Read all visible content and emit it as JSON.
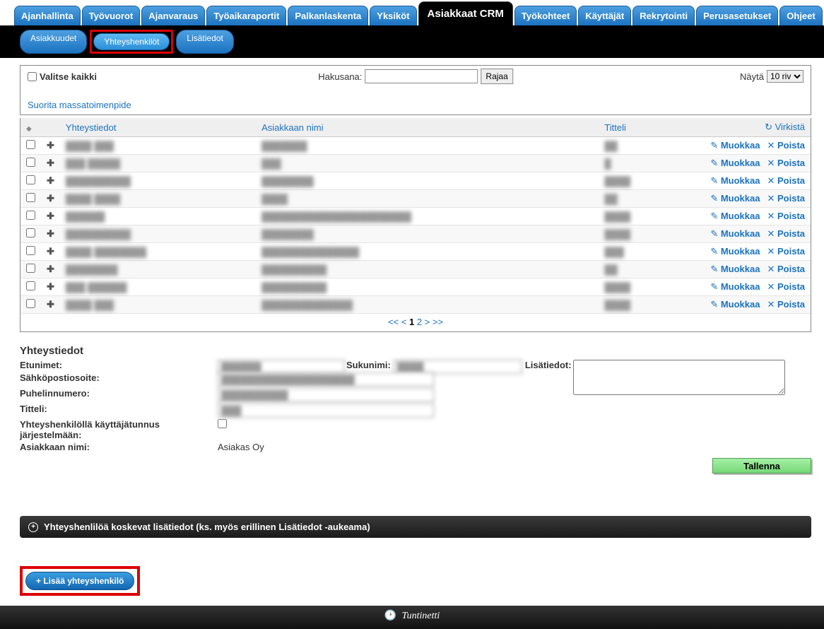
{
  "main_tabs": {
    "items": [
      "Ajanhallinta",
      "Työvuorot",
      "Ajanvaraus",
      "Työaikaraportit",
      "Palkanlaskenta",
      "Yksiköt",
      "Asiakkaat CRM",
      "Työkohteet",
      "Käyttäjät",
      "Rekrytointi",
      "Perusasetukset",
      "Ohjeet"
    ],
    "active_index": 6
  },
  "sub_tabs": {
    "items": [
      "Asiakkuudet",
      "Yhteyshenkilöt",
      "Lisätiedot"
    ],
    "active_index": 1
  },
  "controls": {
    "select_all": "Valitse kaikki",
    "search_label": "Hakusana:",
    "search_value": "",
    "search_button": "Rajaa",
    "rows_label": "Näytä",
    "rows_value": "10 riv",
    "mass_action": "Suorita massatoimenpide"
  },
  "table": {
    "columns": {
      "contact": "Yhteystiedot",
      "customer": "Asiakkaan nimi",
      "title": "Titteli",
      "refresh": "Virkistä"
    },
    "actions": {
      "edit": "Muokkaa",
      "delete": "Poista"
    },
    "rows": [
      {
        "contact": "████ ███",
        "customer": "███████",
        "title": "██"
      },
      {
        "contact": "███ █████",
        "customer": "███",
        "title": "█"
      },
      {
        "contact": "██████████",
        "customer": "████████",
        "title": "████"
      },
      {
        "contact": "████ ████",
        "customer": "████",
        "title": "██"
      },
      {
        "contact": "██████",
        "customer": "███████████████████████",
        "title": "████"
      },
      {
        "contact": "██████████",
        "customer": "████████",
        "title": "████"
      },
      {
        "contact": "████ ████████",
        "customer": "███████████████",
        "title": "███"
      },
      {
        "contact": "████████",
        "customer": "██████████",
        "title": "██"
      },
      {
        "contact": "███ ██████",
        "customer": "██████████",
        "title": "████"
      },
      {
        "contact": "████ ███",
        "customer": "██████████████",
        "title": "████"
      }
    ],
    "pager": {
      "prefix": "<< <",
      "p1": "1",
      "p2": "2",
      "suffix": "> >>"
    }
  },
  "detail": {
    "heading": "Yhteystiedot",
    "labels": {
      "firstnames": "Etunimet:",
      "lastname": "Sukunimi:",
      "extra": "Lisätiedot:",
      "email": "Sähköpostiosoite:",
      "phone": "Puhelinnumero:",
      "title": "Titteli:",
      "has_user": "Yhteyshenkilöllä käyttäjätunnus järjestelmään:",
      "customer": "Asiakkaan nimi:"
    },
    "values": {
      "firstnames": "██████",
      "lastname": "████",
      "email": "████████████████████",
      "phone": "██████████",
      "title": "███",
      "customer": "Asiakas Oy",
      "extra": ""
    },
    "save": "Tallenna"
  },
  "collapse": {
    "label": "Yhteyshenlilöä koskevat lisätiedot (ks. myös erillinen Lisätiedot -aukeama)"
  },
  "add_button": "+ Lisää yhteyshenkilö",
  "footer": {
    "brand": "Tuntinetti"
  }
}
